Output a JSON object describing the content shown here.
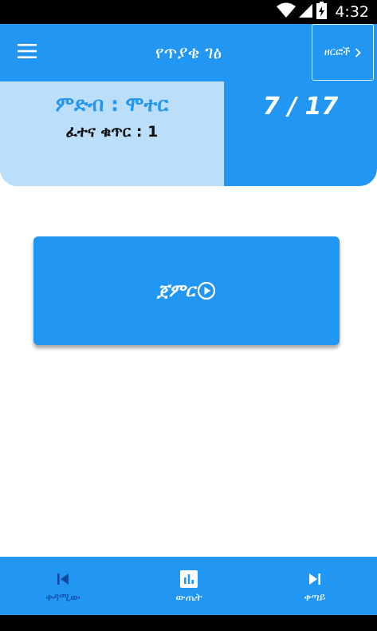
{
  "status_bar": {
    "time": "4:32",
    "icons": [
      "wifi-icon",
      "cell-signal-icon",
      "battery-icon"
    ]
  },
  "app_bar": {
    "title": "የጥያቄ ገፅ",
    "chapters_label": "ዘርፎች",
    "menu_icon": "menu-icon",
    "chevron_icon": "chevron-right-icon"
  },
  "info": {
    "category_label": "ምድብ",
    "category_value": "ሞተር",
    "exam_label": "ፈተና ቁጥር",
    "exam_value": "1",
    "progress": "7 / 17"
  },
  "start": {
    "label": "ጀምር",
    "icon": "play-circle-icon"
  },
  "bottom_nav": {
    "prev_label": "ቀዳሚው",
    "results_label": "ውጤት",
    "next_label": "ቀጣይ"
  },
  "colors": {
    "primary": "#2196f3",
    "panel_light": "#bbdefb",
    "nav_inactive": "#0d47a1"
  }
}
